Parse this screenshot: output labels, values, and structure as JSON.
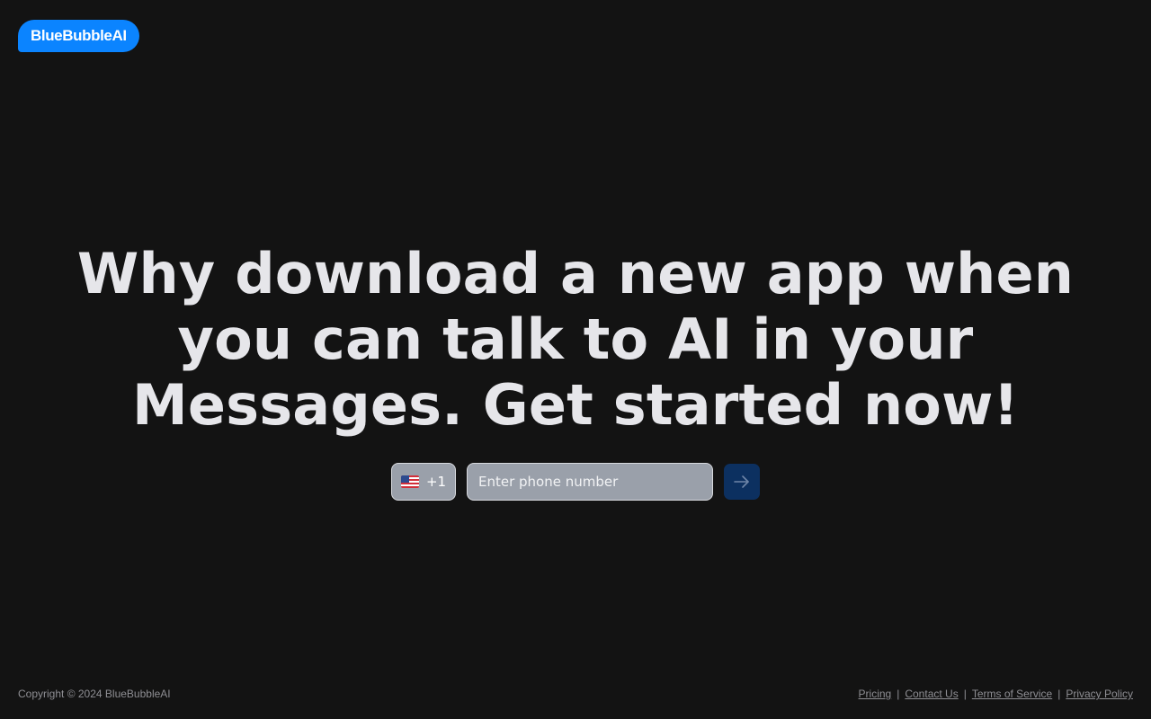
{
  "brand": {
    "logo_text": "BlueBubbleAI",
    "color": "#0b84ff"
  },
  "hero": {
    "headline": "Why download a new app when you can talk to AI in your Messages. Get started now!"
  },
  "form": {
    "country": {
      "flag_icon": "us-flag-icon",
      "code": "+1"
    },
    "phone_placeholder": "Enter phone number",
    "phone_value": "",
    "submit_icon": "arrow-right-icon",
    "submit_color": "#0c3060"
  },
  "footer": {
    "copyright": "Copyright © 2024 BlueBubbleAI",
    "links": {
      "pricing": "Pricing",
      "contact": "Contact Us",
      "terms": "Terms of Service",
      "privacy": "Privacy Policy"
    },
    "separator": "|"
  }
}
